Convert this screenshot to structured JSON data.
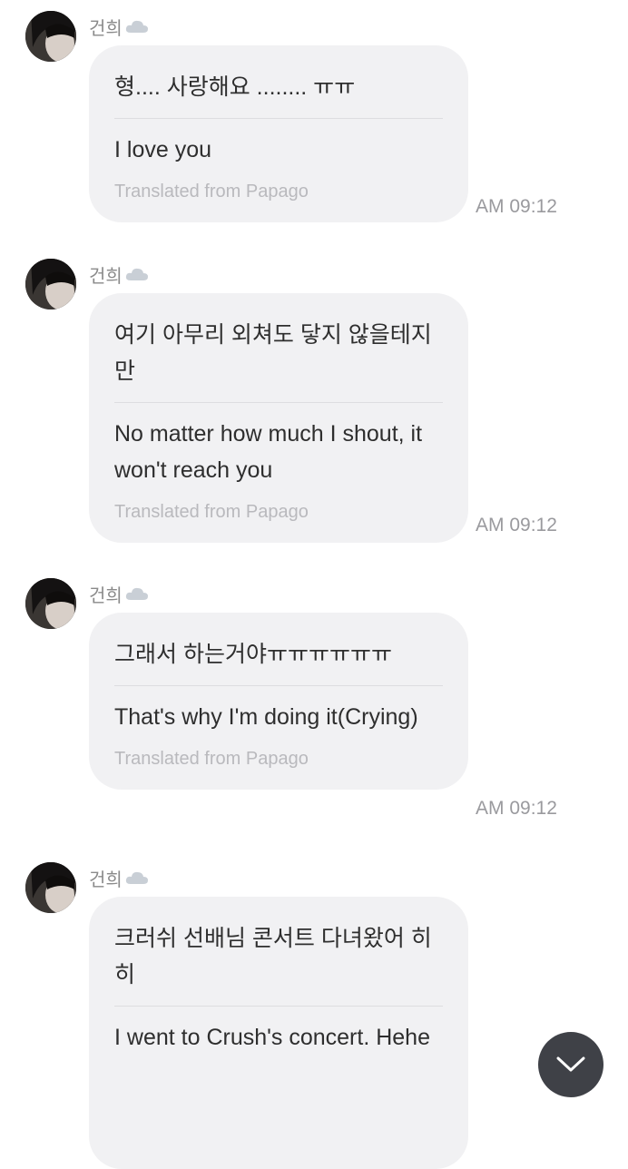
{
  "messages": [
    {
      "sender": "건희",
      "original": "형.... 사랑해요 ........ ㅠㅠ",
      "translation": "I love you",
      "translated_from": "Translated from Papago",
      "time": "AM 09:12"
    },
    {
      "sender": "건희",
      "original": "여기 아무리 외쳐도 닿지 않을테지만",
      "translation": "No matter how much I shout, it won't reach you",
      "translated_from": "Translated from Papago",
      "time": "AM 09:12"
    },
    {
      "sender": "건희",
      "original": "그래서 하는거야ㅠㅠㅠㅠㅠㅠ",
      "translation": "That's why I'm doing it(Crying)",
      "translated_from": "Translated from Papago",
      "time": "AM 09:12"
    },
    {
      "sender": "건희",
      "original": "크러쉬 선배님 콘서트 다녀왔어 히히",
      "translation": "I went to Crush's concert. Hehe",
      "translated_from": "",
      "time": ""
    }
  ],
  "icons": {
    "sender_badge": "cloud-icon",
    "scroll_button": "chevron-down-icon"
  },
  "colors": {
    "bubble": "#f1f1f3",
    "scroll_button": "#3f4147"
  }
}
